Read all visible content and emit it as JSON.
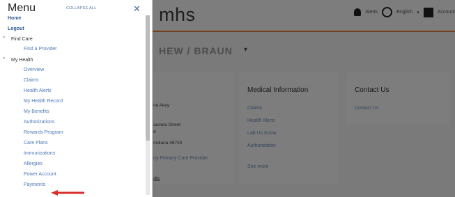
{
  "menu": {
    "title": "Menu",
    "collapse_all": "COLLAPSE ALL",
    "close_icon": "close-icon",
    "items": [
      {
        "label": "Home",
        "level": "top"
      },
      {
        "label": "Logout",
        "level": "top"
      },
      {
        "label": "Find Care",
        "level": "section"
      },
      {
        "label": "Find a Provider",
        "level": "sub"
      },
      {
        "label": "My Health",
        "level": "section"
      },
      {
        "label": "Overview",
        "level": "sub"
      },
      {
        "label": "Claims",
        "level": "sub"
      },
      {
        "label": "Health Alerts",
        "level": "sub"
      },
      {
        "label": "My Health Record",
        "level": "sub"
      },
      {
        "label": "My Benefits",
        "level": "sub"
      },
      {
        "label": "Authorizations",
        "level": "sub"
      },
      {
        "label": "Rewards Program",
        "level": "sub"
      },
      {
        "label": "Care Plans",
        "level": "sub"
      },
      {
        "label": "Immunizations",
        "level": "sub"
      },
      {
        "label": "Allergies",
        "level": "sub"
      },
      {
        "label": "Power Account",
        "level": "sub"
      },
      {
        "label": "Payments",
        "level": "sub"
      }
    ]
  },
  "header": {
    "logo": "mhs",
    "alerts": "Alerts",
    "language": "English",
    "account": "Account"
  },
  "breadcrumb": "HEW / BRAUN",
  "cards": {
    "left": {
      "line1": "ne Akey",
      "line2": "aumee Street",
      "line3": "d",
      "line4": "Indiana 46703",
      "link": "ny Primary Care Provider",
      "footer": "ds"
    },
    "medical": {
      "title": "Medical Information",
      "links": [
        "Claims",
        "Health Alerts",
        "Lab Us Know",
        "Authorization"
      ],
      "see_more": "See more"
    },
    "contact": {
      "title": "Contact Us",
      "link": "Contact Us"
    }
  },
  "colors": {
    "accent": "#e6833a",
    "link": "#4d79b7",
    "arrow": "#d9302c"
  }
}
